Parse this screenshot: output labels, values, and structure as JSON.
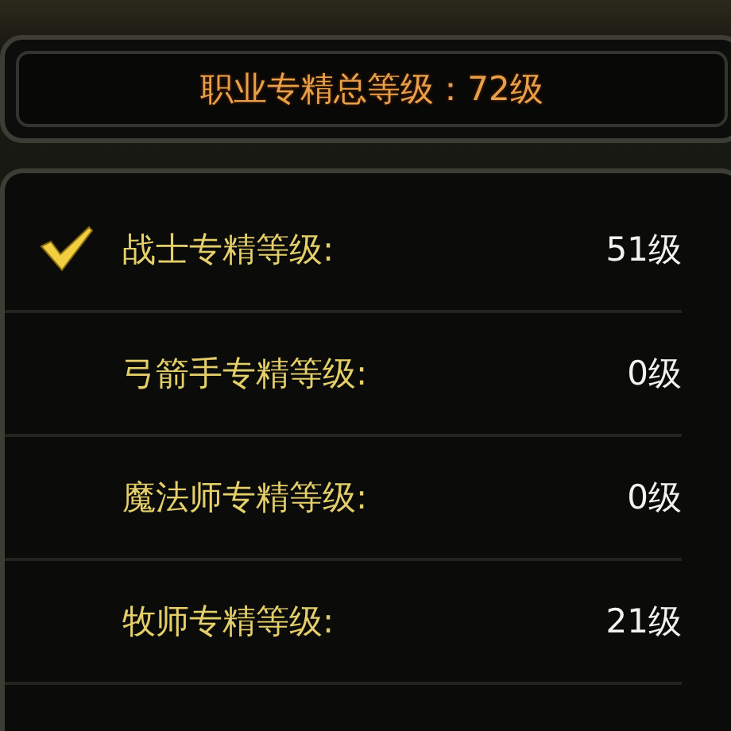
{
  "header": {
    "title": "职业专精总等级：72级"
  },
  "rows": [
    {
      "label": "战士专精等级:",
      "value": "51级",
      "checked": true
    },
    {
      "label": "弓箭手专精等级:",
      "value": "0级",
      "checked": false
    },
    {
      "label": "魔法师专精等级:",
      "value": "0级",
      "checked": false
    },
    {
      "label": "牧师专精等级:",
      "value": "21级",
      "checked": false
    }
  ]
}
